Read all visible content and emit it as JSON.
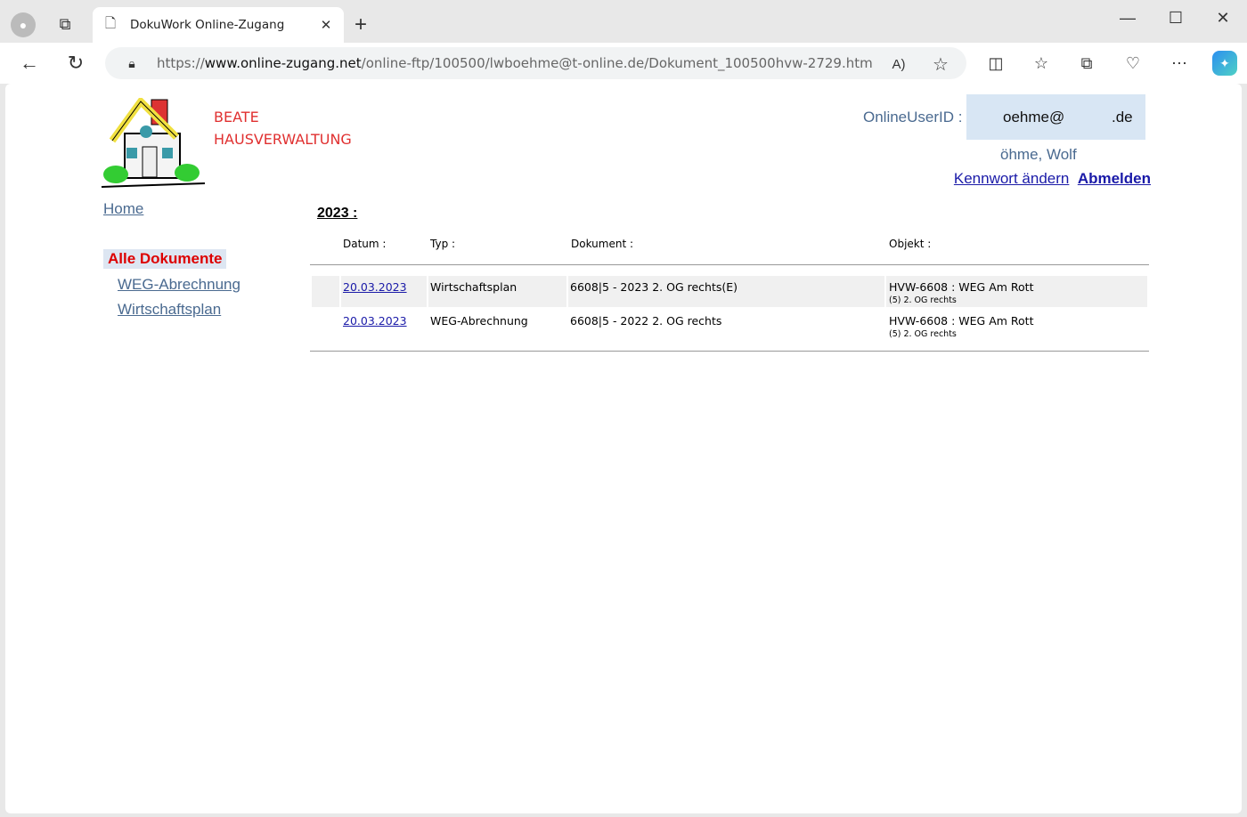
{
  "browser": {
    "tab_title": "DokuWork Online-Zugang",
    "url_prefix": "https://",
    "url_domain": "www.online-zugang.net",
    "url_path": "/online-ftp/100500/lwboehme@t-online.de/Dokument_100500hvw-2729.htm"
  },
  "brand": {
    "line1": "BEATE",
    "line2": "HAUSVERWALTUNG"
  },
  "user": {
    "id_label": "OnlineUserID :",
    "id_part1": "oehme@",
    "id_part2": ".de",
    "name": "öhme, Wolf",
    "change_password": "Kennwort ändern",
    "logout": "Abmelden"
  },
  "nav": {
    "home": "Home",
    "all": "Alle Dokumente",
    "items": [
      "WEG-Abrechnung",
      "Wirtschaftsplan"
    ]
  },
  "year": "2023 :",
  "table": {
    "headers": [
      "Datum :",
      "Typ :",
      "Dokument :",
      "Objekt :"
    ],
    "rows": [
      {
        "date": "20.03.2023",
        "type": "Wirtschaftsplan",
        "doc": "6608|5 - 2023 2. OG rechts(E)",
        "obj": "HVW-6608 : WEG Am Rott",
        "obj_sub": "(5) 2. OG rechts"
      },
      {
        "date": "20.03.2023",
        "type": "WEG-Abrechnung",
        "doc": "6608|5 - 2022 2. OG rechts",
        "obj": "HVW-6608 : WEG Am Rott",
        "obj_sub": "(5) 2. OG rechts"
      }
    ]
  }
}
